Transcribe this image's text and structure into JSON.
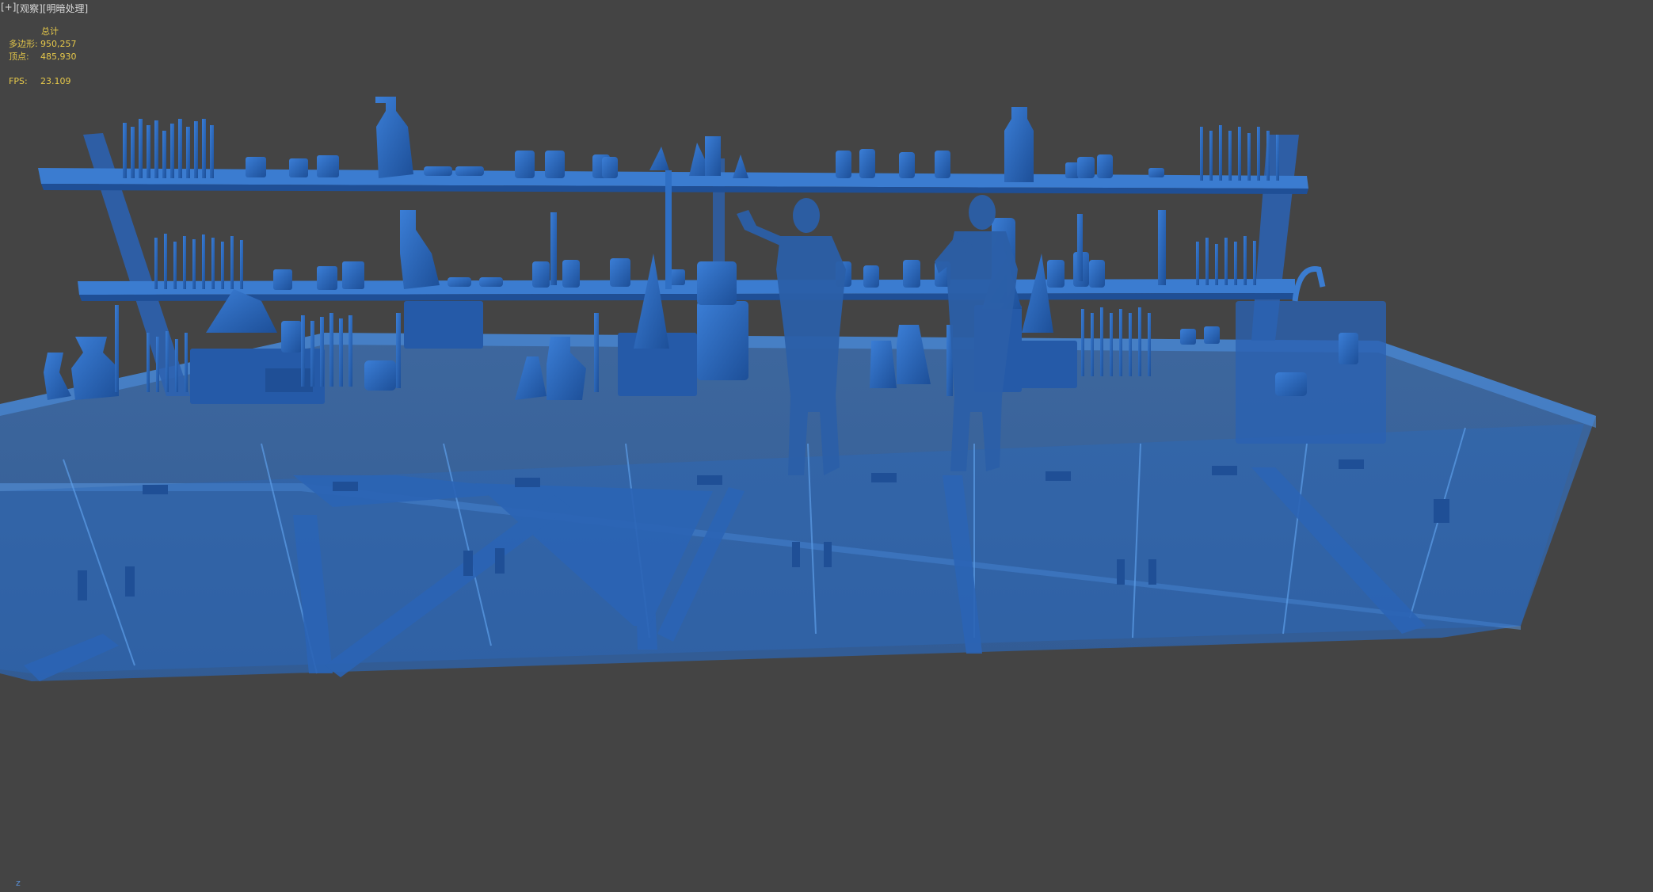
{
  "viewport": {
    "labels": {
      "plus": "[+]",
      "view": "[观察]",
      "shading": "[明暗处理]"
    },
    "stats": {
      "header": "总计",
      "polys_label": "多边形:",
      "polys_value": "950,257",
      "verts_label": "顶点:",
      "verts_value": "485,930",
      "fps_label": "FPS:",
      "fps_value": "23.109"
    },
    "axis_label": "z"
  },
  "colors": {
    "background": "#444444",
    "model_blue": "#2f6fc4",
    "model_dark": "#1f4f96",
    "stats_text": "#e6c84a",
    "label_text": "#d9d9d9"
  }
}
